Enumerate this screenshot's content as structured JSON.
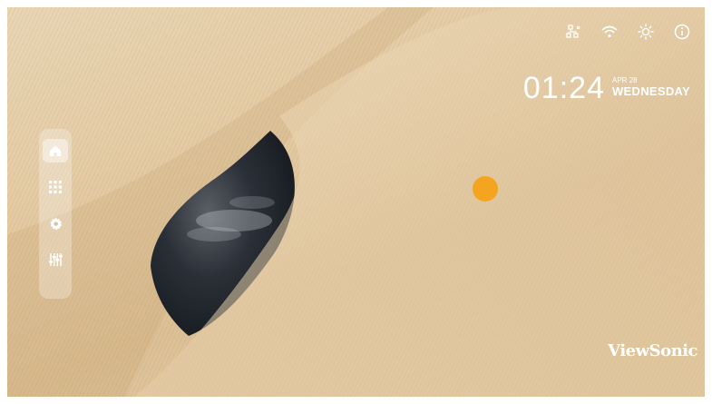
{
  "status_bar": {
    "icons": [
      "network-icon",
      "wifi-icon",
      "brightness-icon",
      "info-icon"
    ]
  },
  "clock": {
    "time": "01:24",
    "month": "APR 28",
    "weekday": "WEDNESDAY"
  },
  "sidebar": {
    "items": [
      {
        "icon": "home-icon",
        "active": true
      },
      {
        "icon": "apps-grid-icon",
        "active": false
      },
      {
        "icon": "settings-gear-icon",
        "active": false
      },
      {
        "icon": "equalizer-icon",
        "active": false
      }
    ]
  },
  "brand": {
    "logo_text": "ViewSonic"
  },
  "colors": {
    "accent": "#f5a41f",
    "wood": "#e3caa3",
    "sky": "#1f252d"
  }
}
